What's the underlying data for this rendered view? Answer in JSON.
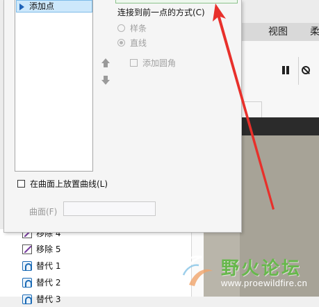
{
  "ribbon": {
    "tabs": [
      "视图",
      "柔"
    ],
    "controls": [
      "pause-icon",
      "stop-icon"
    ]
  },
  "dialog": {
    "point_list": [
      {
        "label": "添加点",
        "selected": true
      }
    ],
    "connect_heading": "连接到前一点的方式(C)",
    "options": [
      {
        "label": "样条",
        "selected": false,
        "enabled": false
      },
      {
        "label": "直线",
        "selected": true,
        "enabled": false
      }
    ],
    "add_fillet": {
      "label": "添加圆角",
      "checked": false,
      "enabled": false
    },
    "place_on_surface": {
      "label": "在曲面上放置曲线(L)",
      "checked": false
    },
    "surface": {
      "label": "曲面(F)",
      "value": ""
    }
  },
  "model_tree": {
    "items": [
      {
        "label": "移除 4",
        "icon": "remove-icon"
      },
      {
        "label": "移除 5",
        "icon": "remove-icon"
      },
      {
        "label": "替代 1",
        "icon": "replace-icon"
      },
      {
        "label": "替代 2",
        "icon": "replace-icon"
      },
      {
        "label": "替代 3",
        "icon": "replace-icon"
      }
    ]
  },
  "watermark": {
    "title": "野火论坛",
    "url": "www.proewildfire.cn"
  },
  "colors": {
    "annotation_arrow": "#e8302b",
    "selection": "#cde8fb",
    "watermark_green": "#67b84c",
    "viewport": "#a7a397"
  }
}
